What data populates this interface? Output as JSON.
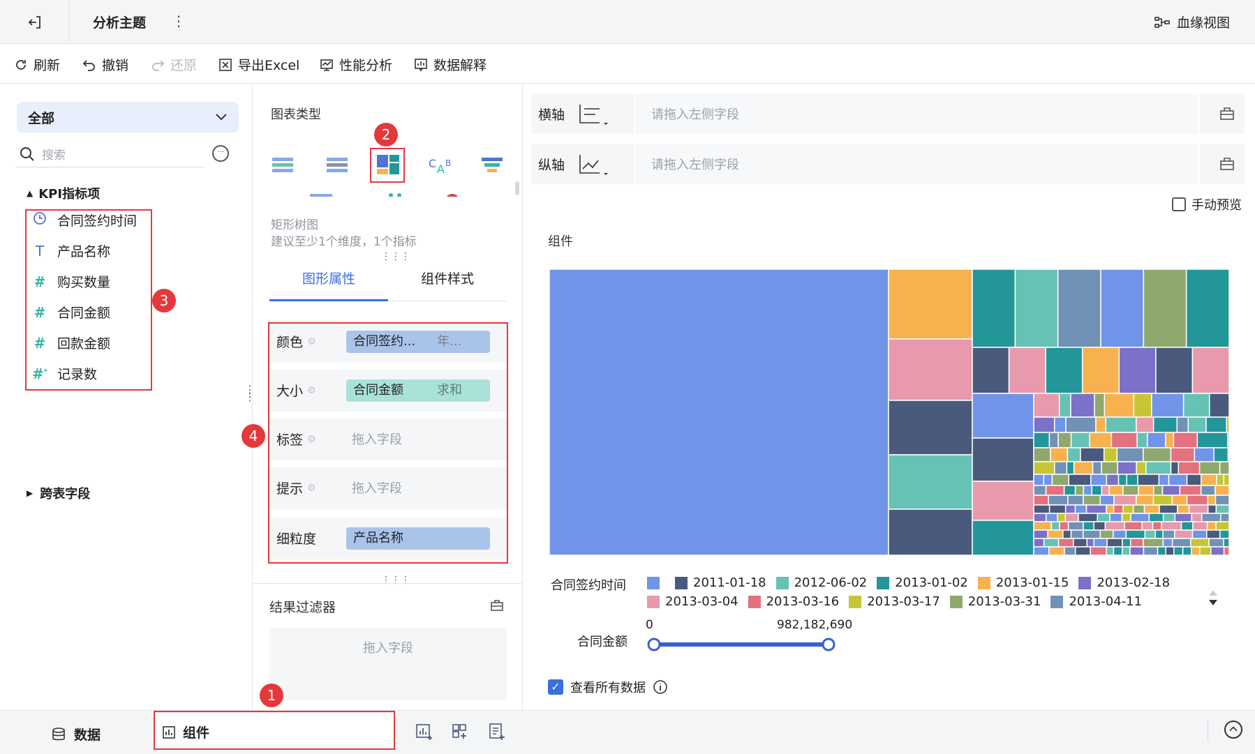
{
  "topbar": {
    "title": "分析主题",
    "more": "⋮",
    "lineage": "血缘视图"
  },
  "toolbar": {
    "refresh": "刷新",
    "undo": "撤销",
    "redo": "还原",
    "export_excel": "导出Excel",
    "performance": "性能分析",
    "data_explain": "数据解释"
  },
  "left": {
    "scope": "全部",
    "search_placeholder": "搜索",
    "kpi_group": "KPI指标项",
    "fields": [
      {
        "icon": "clock-icon",
        "label": "合同签约时间"
      },
      {
        "icon": "text-field-icon",
        "label": "产品名称"
      },
      {
        "icon": "number-field-icon",
        "label": "购买数量"
      },
      {
        "icon": "number-field-icon",
        "label": "合同金额"
      },
      {
        "icon": "number-field-icon",
        "label": "回款金额"
      },
      {
        "icon": "record-count-icon",
        "label": "记录数"
      }
    ],
    "cross_group": "跨表字段"
  },
  "badges": [
    "1",
    "2",
    "3",
    "4"
  ],
  "mid": {
    "chart_type_title": "图表类型",
    "chart_name": "矩形树图",
    "chart_hint": "建议至少1个维度，1个指标",
    "tabs": [
      "图形属性",
      "组件样式"
    ],
    "props": [
      {
        "label": "颜色",
        "chip": "合同签约...",
        "sub": "年...",
        "type": "blue"
      },
      {
        "label": "大小",
        "chip": "合同金额",
        "sub": "求和",
        "type": "green"
      },
      {
        "label": "标签",
        "placeholder": "拖入字段"
      },
      {
        "label": "提示",
        "placeholder": "拖入字段"
      },
      {
        "label": "细粒度",
        "chip": "产品名称",
        "type": "blue"
      }
    ],
    "filter_title": "结果过滤器",
    "filter_placeholder": "拖入字段"
  },
  "right": {
    "x_axis": "横轴",
    "y_axis": "纵轴",
    "axis_placeholder": "请拖入左侧字段",
    "manual_preview": "手动预览",
    "component_title": "组件",
    "legend_title": "合同签约时间",
    "legend": [
      {
        "label": "",
        "color": "#7094e8"
      },
      {
        "label": "2011-01-18",
        "color": "#4a5a7c"
      },
      {
        "label": "2012-06-02",
        "color": "#66c2b5"
      },
      {
        "label": "2013-01-02",
        "color": "#23969a"
      },
      {
        "label": "2013-01-15",
        "color": "#f7b24f"
      },
      {
        "label": "2013-02-18",
        "color": "#7b71c8"
      },
      {
        "label": "2013-03-04",
        "color": "#e89aac"
      },
      {
        "label": "2013-03-16",
        "color": "#e3717e"
      },
      {
        "label": "2013-03-17",
        "color": "#c6c634"
      },
      {
        "label": "2013-03-31",
        "color": "#8fa86e"
      },
      {
        "label": "2013-04-11",
        "color": "#7192b7"
      }
    ],
    "amount_title": "合同金额",
    "slider_min": "0",
    "slider_max": "982,182,690",
    "view_all": "查看所有数据"
  },
  "bottombar": {
    "data_tab": "数据",
    "component_tab": "组件"
  },
  "colors": {
    "accent": "#3a6fe2",
    "annotation": "#e5383b"
  }
}
